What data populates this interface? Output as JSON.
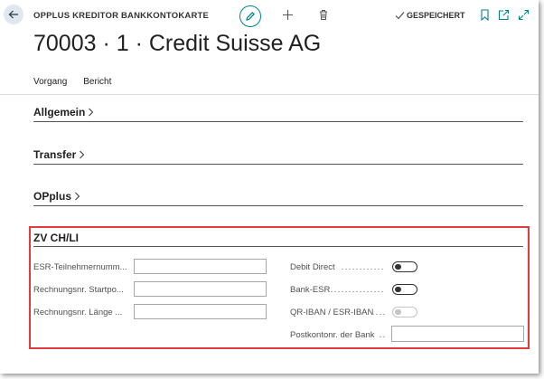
{
  "header": {
    "caption": "OPPLUS KREDITOR BANKKONTOKARTE",
    "title": "70003 · 1 · Credit Suisse AG",
    "saved_status": "GESPEICHERT"
  },
  "actions": [
    "Vorgang",
    "Bericht"
  ],
  "fasttabs": {
    "allgemein": "Allgemein",
    "transfer": "Transfer",
    "opplus": "OPplus",
    "zv": "ZV CH/LI"
  },
  "zv_fields": {
    "esr_teilnehmer": {
      "label": "ESR-Teilnehmernumm...",
      "value": ""
    },
    "rechnungsnr_start": {
      "label": "Rechnungsnr. Startpo...",
      "value": ""
    },
    "rechnungsnr_laenge": {
      "label": "Rechnungsnr. Länge ...",
      "value": ""
    },
    "debit_direct": {
      "label": "Debit Direct",
      "on": false
    },
    "bank_esr": {
      "label": "Bank-ESR",
      "on": false
    },
    "qr_iban": {
      "label": "QR-IBAN / ESR-IBAN",
      "on": false,
      "disabled": true
    },
    "postkontonr": {
      "label": "Postkontonr. der Bank",
      "value": ""
    }
  },
  "colors": {
    "accent": "#008489",
    "highlight_border": "#e23c3c"
  }
}
